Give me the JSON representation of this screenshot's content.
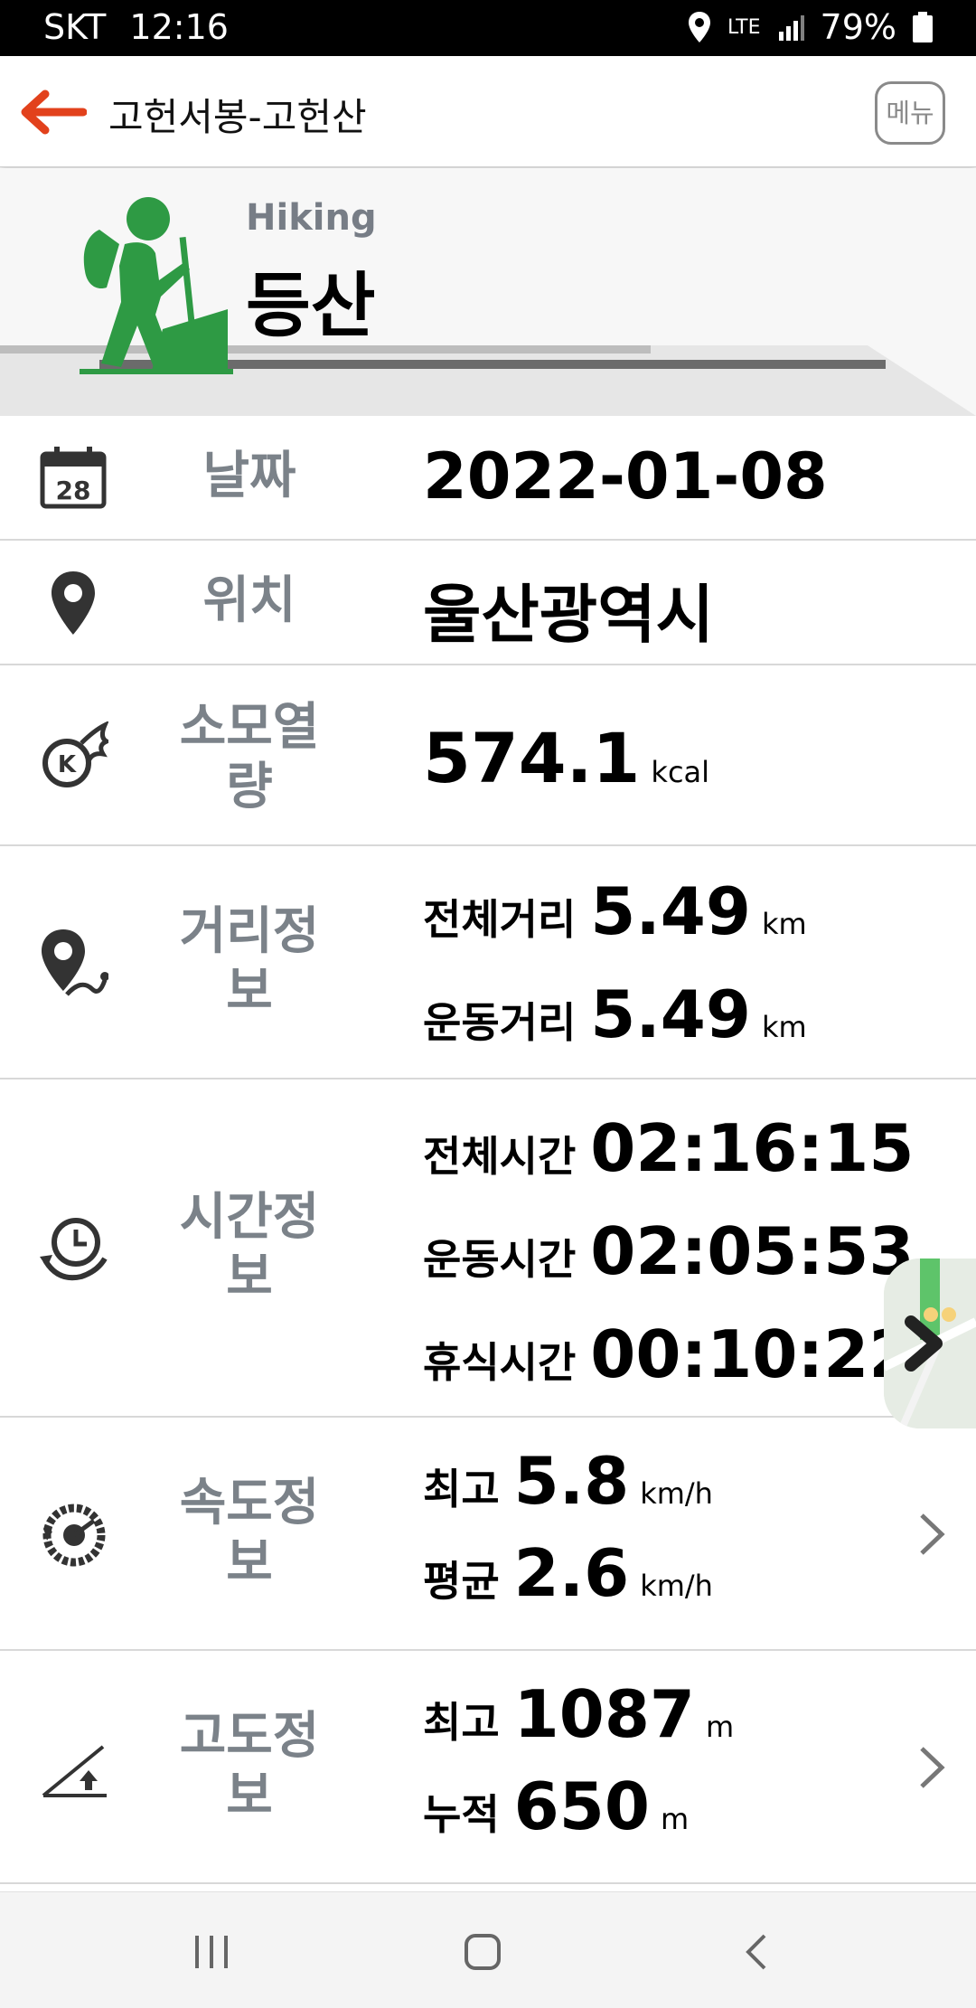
{
  "status": {
    "carrier": "SKT",
    "time": "12:16",
    "network": "LTE",
    "battery": "79%"
  },
  "app_bar": {
    "title": "고헌서봉-고헌산",
    "menu_label": "메뉴"
  },
  "hero": {
    "subtitle": "Hiking",
    "title": "등산"
  },
  "date": {
    "label": "날짜",
    "calendar_day": "28",
    "value": "2022-01-08"
  },
  "location": {
    "label": "위치",
    "value": "울산광역시"
  },
  "calories": {
    "label_line1": "소모열",
    "label_line2": "량",
    "value": "574.1",
    "unit": "kcal"
  },
  "distance": {
    "label_line1": "거리정",
    "label_line2": "보",
    "total_label": "전체거리",
    "total_value": "5.49",
    "total_unit": "km",
    "active_label": "운동거리",
    "active_value": "5.49",
    "active_unit": "km"
  },
  "time_info": {
    "label_line1": "시간정",
    "label_line2": "보",
    "total_label": "전체시간",
    "total_value": "02:16:15",
    "active_label": "운동시간",
    "active_value": "02:05:53",
    "rest_label": "휴식시간",
    "rest_value": "00:10:22"
  },
  "speed": {
    "label_line1": "속도정",
    "label_line2": "보",
    "max_label": "최고",
    "max_value": "5.8",
    "max_unit": "km/h",
    "avg_label": "평균",
    "avg_value": "2.6",
    "avg_unit": "km/h"
  },
  "altitude": {
    "label_line1": "고도정",
    "label_line2": "보",
    "max_label": "최고",
    "max_value": "1087",
    "max_unit": "m",
    "cum_label": "누적",
    "cum_value": "650",
    "cum_unit": "m"
  },
  "colors": {
    "accent": "#e2411c",
    "hiker_green": "#2e9a44",
    "label_gray": "#7b8289"
  }
}
